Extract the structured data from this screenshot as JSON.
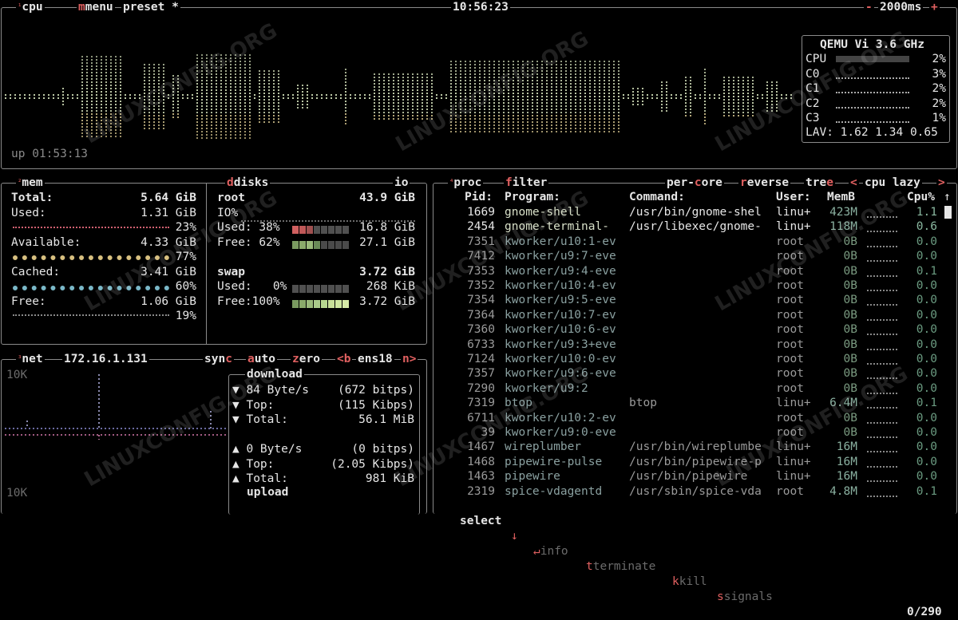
{
  "cpu": {
    "num": "¹",
    "tab": "cpu",
    "menu": "menu",
    "preset": "preset *",
    "clock": "10:56:23",
    "minus": "-",
    "interval": "2000ms",
    "plus": "+",
    "uptime": "up 01:53:13",
    "model": "QEMU Vi",
    "freq": "3.6 GHz",
    "cores": [
      {
        "label": "CPU",
        "pct": "2%",
        "frac": 0.02
      },
      {
        "label": "C0",
        "pct": "3%",
        "frac": 0.03
      },
      {
        "label": "C1",
        "pct": "2%",
        "frac": 0.02
      },
      {
        "label": "C2",
        "pct": "2%",
        "frac": 0.02
      },
      {
        "label": "C3",
        "pct": "1%",
        "frac": 0.01
      }
    ],
    "lav_label": "LAV:",
    "lav": "1.62 1.34 0.65"
  },
  "mem": {
    "num": "²",
    "tab": "mem",
    "total_label": "Total:",
    "total": "5.64 GiB",
    "used_label": "Used:",
    "used": "1.31 GiB",
    "used_pct": "23%",
    "avail_label": "Available:",
    "avail": "4.33 GiB",
    "avail_pct": "77%",
    "cached_label": "Cached:",
    "cached": "3.41 GiB",
    "cached_pct": "60%",
    "free_label": "Free:",
    "free": "1.06 GiB",
    "free_pct": "19%"
  },
  "disks": {
    "tab": "disks",
    "io": "io",
    "root_label": "root",
    "root_size": "43.9 GiB",
    "io_label": "IO%",
    "used_label": "Used: 38%",
    "used": "16.8 GiB",
    "free_label": "Free: 62%",
    "free": "27.1 GiB",
    "swap_label": "swap",
    "swap_size": "3.72 GiB",
    "swap_used_label": "Used:   0%",
    "swap_used": "268 KiB",
    "swap_free_label": "Free:100%",
    "swap_free": "3.72 GiB"
  },
  "net": {
    "num": "³",
    "tab": "net",
    "ip": "172.16.1.131",
    "sync": "sync",
    "auto": "auto",
    "zero": "zero",
    "prev": "<b",
    "iface": "ens18",
    "next": "n>",
    "scale_top": "10K",
    "scale_bottom": "10K",
    "download": "download",
    "upload": "upload",
    "down_rows": [
      {
        "arrow": "▼",
        "label": "84 Byte/s",
        "value": "(672 bitps)"
      },
      {
        "arrow": "▼",
        "label": "Top:",
        "value": "(115 Kibps)"
      },
      {
        "arrow": "▼",
        "label": "Total:",
        "value": "56.1 MiB"
      }
    ],
    "up_rows": [
      {
        "arrow": "▲",
        "label": "0 Byte/s",
        "value": "(0 bitps)"
      },
      {
        "arrow": "▲",
        "label": "Top:",
        "value": "(2.05 Kibps)"
      },
      {
        "arrow": "▲",
        "label": "Total:",
        "value": "981 KiB"
      }
    ]
  },
  "proc": {
    "num": "⁴",
    "tab": "proc",
    "filter": "filter",
    "percore": "per-core",
    "reverse": "reverse",
    "tree": "tree",
    "lt": "<",
    "sort": "cpu lazy",
    "gt": ">",
    "headers": {
      "pid": "Pid:",
      "program": "Program:",
      "command": "Command:",
      "user": "User:",
      "mem": "MemB",
      "cpu": "Cpu%"
    },
    "rows": [
      {
        "pid": "1669",
        "program": "gnome-shell",
        "command": "/usr/bin/gnome-shel",
        "user": "linu+",
        "mem": "423M",
        "cpu": "1.1",
        "bright": true
      },
      {
        "pid": "2454",
        "program": "gnome-terminal-",
        "command": "/usr/libexec/gnome-",
        "user": "linu+",
        "mem": "118M",
        "cpu": "0.6",
        "bright": true
      },
      {
        "pid": "7351",
        "program": "kworker/u10:1-ev",
        "command": "",
        "user": "root",
        "mem": "0B",
        "cpu": "0.0",
        "bright": false
      },
      {
        "pid": "7412",
        "program": "kworker/u9:7-eve",
        "command": "",
        "user": "root",
        "mem": "0B",
        "cpu": "0.0",
        "bright": false
      },
      {
        "pid": "7353",
        "program": "kworker/u9:4-eve",
        "command": "",
        "user": "root",
        "mem": "0B",
        "cpu": "0.1",
        "bright": false
      },
      {
        "pid": "7352",
        "program": "kworker/u10:4-ev",
        "command": "",
        "user": "root",
        "mem": "0B",
        "cpu": "0.0",
        "bright": false
      },
      {
        "pid": "7354",
        "program": "kworker/u9:5-eve",
        "command": "",
        "user": "root",
        "mem": "0B",
        "cpu": "0.0",
        "bright": false
      },
      {
        "pid": "7364",
        "program": "kworker/u10:7-ev",
        "command": "",
        "user": "root",
        "mem": "0B",
        "cpu": "0.0",
        "bright": false
      },
      {
        "pid": "7360",
        "program": "kworker/u10:6-ev",
        "command": "",
        "user": "root",
        "mem": "0B",
        "cpu": "0.0",
        "bright": false
      },
      {
        "pid": "6733",
        "program": "kworker/u9:3+eve",
        "command": "",
        "user": "root",
        "mem": "0B",
        "cpu": "0.0",
        "bright": false
      },
      {
        "pid": "7124",
        "program": "kworker/u10:0-ev",
        "command": "",
        "user": "root",
        "mem": "0B",
        "cpu": "0.0",
        "bright": false
      },
      {
        "pid": "7357",
        "program": "kworker/u9:6-eve",
        "command": "",
        "user": "root",
        "mem": "0B",
        "cpu": "0.0",
        "bright": false
      },
      {
        "pid": "7290",
        "program": "kworker/u9:2",
        "command": "",
        "user": "root",
        "mem": "0B",
        "cpu": "0.0",
        "bright": false
      },
      {
        "pid": "7319",
        "program": "btop",
        "command": "btop",
        "user": "linu+",
        "mem": "6.4M",
        "cpu": "0.1",
        "bright": false
      },
      {
        "pid": "6711",
        "program": "kworker/u10:2-ev",
        "command": "",
        "user": "root",
        "mem": "0B",
        "cpu": "0.0",
        "bright": false
      },
      {
        "pid": "39",
        "program": "kworker/u9:0-eve",
        "command": "",
        "user": "root",
        "mem": "0B",
        "cpu": "0.0",
        "bright": false
      },
      {
        "pid": "1467",
        "program": "wireplumber",
        "command": "/usr/bin/wireplumbe",
        "user": "linu+",
        "mem": "16M",
        "cpu": "0.0",
        "bright": false
      },
      {
        "pid": "1468",
        "program": "pipewire-pulse",
        "command": "/usr/bin/pipewire-p",
        "user": "linu+",
        "mem": "16M",
        "cpu": "0.0",
        "bright": false
      },
      {
        "pid": "1463",
        "program": "pipewire",
        "command": "/usr/bin/pipewire",
        "user": "linu+",
        "mem": "16M",
        "cpu": "0.0",
        "bright": false
      },
      {
        "pid": "2319",
        "program": "spice-vdagentd",
        "command": "/usr/sbin/spice-vda",
        "user": "root",
        "mem": "4.8M",
        "cpu": "0.1",
        "bright": false
      }
    ],
    "footer": {
      "select": "select",
      "info": "info",
      "terminate": "terminate",
      "kill": "kill",
      "signals": "signals",
      "count": "0/290"
    }
  },
  "watermark": "LINUXCONFIG.ORG",
  "colors": {
    "accent": "#e06060",
    "graph": "#c8d4b0",
    "border": "#8a8a8a"
  }
}
